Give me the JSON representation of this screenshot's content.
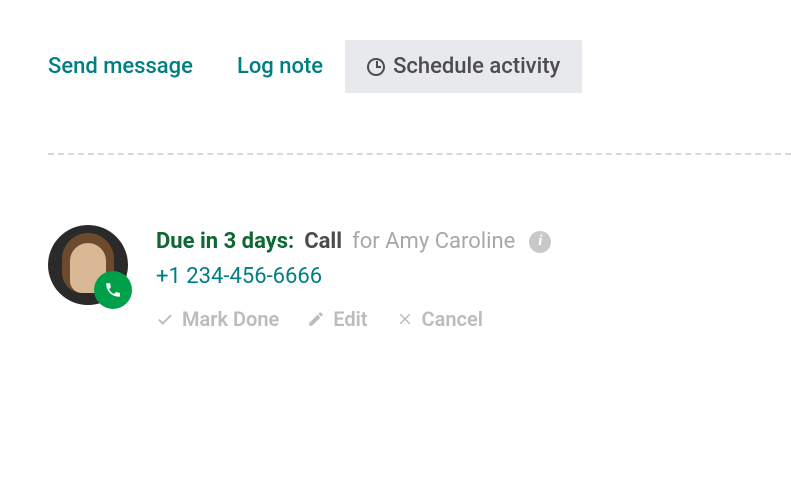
{
  "tabs": {
    "send_message": "Send message",
    "log_note": "Log note",
    "schedule_activity": "Schedule activity"
  },
  "activity": {
    "due_label": "Due in 3 days:",
    "type": "Call",
    "assignee": "for Amy Caroline",
    "phone": "+1 234-456-6666"
  },
  "actions": {
    "mark_done": "Mark Done",
    "edit": "Edit",
    "cancel": "Cancel"
  }
}
